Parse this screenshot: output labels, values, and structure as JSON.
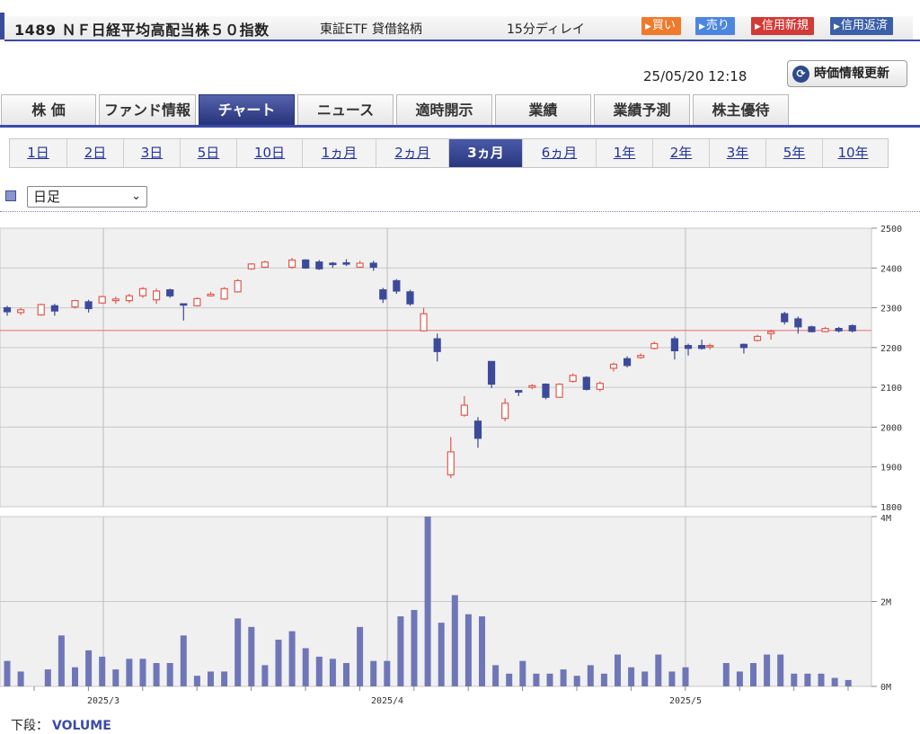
{
  "header": {
    "title": "1489 ＮＦ日経平均高配当株５０指数",
    "market": "東証ETF 貸借銘柄",
    "delay": "15分ディレイ",
    "buttons": {
      "buy": "買い",
      "sell": "売り",
      "margin_new": "信用新規",
      "margin_return": "信用返済"
    },
    "colors": {
      "buy": "#f07a2c",
      "sell": "#4d86e0",
      "margin_new": "#d23a36",
      "margin_return": "#3b5fa8",
      "accent": "#3b4aa8"
    }
  },
  "timestamp": "25/05/20 12:18",
  "refresh": {
    "label": "時価情報更新",
    "icon": "refresh-icon"
  },
  "tabs": [
    {
      "label": "株 価",
      "active": false
    },
    {
      "label": "ファンド情報",
      "active": false
    },
    {
      "label": "チャート",
      "active": true
    },
    {
      "label": "ニュース",
      "active": false
    },
    {
      "label": "適時開示",
      "active": false
    },
    {
      "label": "業績",
      "active": false
    },
    {
      "label": "業績予測",
      "active": false
    },
    {
      "label": "株主優待",
      "active": false
    }
  ],
  "periods": [
    {
      "label": "1日",
      "active": false
    },
    {
      "label": "2日",
      "active": false
    },
    {
      "label": "3日",
      "active": false
    },
    {
      "label": "5日",
      "active": false
    },
    {
      "label": "10日",
      "active": false
    },
    {
      "label": "1ヵ月",
      "active": false
    },
    {
      "label": "2ヵ月",
      "active": false
    },
    {
      "label": "3ヵ月",
      "active": true
    },
    {
      "label": "6ヵ月",
      "active": false
    },
    {
      "label": "1年",
      "active": false
    },
    {
      "label": "2年",
      "active": false
    },
    {
      "label": "3年",
      "active": false
    },
    {
      "label": "5年",
      "active": false
    },
    {
      "label": "10年",
      "active": false
    }
  ],
  "candle_type": "日足",
  "footer": {
    "prefix": "下段：",
    "indicator": "VOLUME"
  },
  "chart_data": {
    "type": "candlestick",
    "title": "",
    "price_axis": {
      "min": 1800,
      "max": 2500,
      "ticks": [
        2500,
        2400,
        2300,
        2200,
        2100,
        2000,
        1900,
        1800
      ]
    },
    "volume_axis": {
      "min": 0,
      "max": 4000000,
      "ticks": [
        "4M",
        "2M",
        "0M"
      ]
    },
    "x_labels": [
      "2025/3",
      "2025/4",
      "2025/5"
    ],
    "reference_line": 2243,
    "colors": {
      "up": "#e05a4f",
      "down": "#3d4a9a",
      "volume": "#6f76b8",
      "ref": "#e57b7b",
      "grid": "#c8c8c8"
    },
    "candles": [
      {
        "o": 2300,
        "h": 2305,
        "l": 2280,
        "c": 2290
      },
      {
        "o": 2288,
        "h": 2300,
        "l": 2282,
        "c": 2295
      },
      {
        "o": 2282,
        "h": 2310,
        "l": 2280,
        "c": 2308
      },
      {
        "o": 2305,
        "h": 2310,
        "l": 2280,
        "c": 2292
      },
      {
        "o": 2302,
        "h": 2320,
        "l": 2298,
        "c": 2318
      },
      {
        "o": 2315,
        "h": 2320,
        "l": 2288,
        "c": 2298
      },
      {
        "o": 2312,
        "h": 2330,
        "l": 2310,
        "c": 2328
      },
      {
        "o": 2318,
        "h": 2328,
        "l": 2310,
        "c": 2322
      },
      {
        "o": 2318,
        "h": 2335,
        "l": 2312,
        "c": 2330
      },
      {
        "o": 2330,
        "h": 2352,
        "l": 2325,
        "c": 2348
      },
      {
        "o": 2320,
        "h": 2348,
        "l": 2310,
        "c": 2342
      },
      {
        "o": 2345,
        "h": 2348,
        "l": 2325,
        "c": 2330
      },
      {
        "o": 2310,
        "h": 2310,
        "l": 2268,
        "c": 2308
      },
      {
        "o": 2305,
        "h": 2326,
        "l": 2303,
        "c": 2323
      },
      {
        "o": 2330,
        "h": 2340,
        "l": 2328,
        "c": 2334
      },
      {
        "o": 2322,
        "h": 2352,
        "l": 2320,
        "c": 2348
      },
      {
        "o": 2340,
        "h": 2372,
        "l": 2338,
        "c": 2368
      },
      {
        "o": 2398,
        "h": 2412,
        "l": 2395,
        "c": 2410
      },
      {
        "o": 2402,
        "h": 2418,
        "l": 2400,
        "c": 2415
      },
      {
        "o": 2402,
        "h": 2425,
        "l": 2398,
        "c": 2420
      },
      {
        "o": 2420,
        "h": 2422,
        "l": 2398,
        "c": 2400
      },
      {
        "o": 2415,
        "h": 2420,
        "l": 2395,
        "c": 2398
      },
      {
        "o": 2412,
        "h": 2415,
        "l": 2400,
        "c": 2410
      },
      {
        "o": 2413,
        "h": 2422,
        "l": 2405,
        "c": 2412
      },
      {
        "o": 2402,
        "h": 2418,
        "l": 2400,
        "c": 2412
      },
      {
        "o": 2412,
        "h": 2418,
        "l": 2393,
        "c": 2402
      },
      {
        "o": 2345,
        "h": 2350,
        "l": 2312,
        "c": 2322
      },
      {
        "o": 2368,
        "h": 2372,
        "l": 2335,
        "c": 2342
      },
      {
        "o": 2340,
        "h": 2345,
        "l": 2305,
        "c": 2310
      },
      {
        "o": 2242,
        "h": 2300,
        "l": 2240,
        "c": 2285
      },
      {
        "o": 2222,
        "h": 2235,
        "l": 2165,
        "c": 2190
      },
      {
        "o": 1880,
        "h": 1975,
        "l": 1872,
        "c": 1938
      },
      {
        "o": 2030,
        "h": 2078,
        "l": 2026,
        "c": 2055
      },
      {
        "o": 2015,
        "h": 2025,
        "l": 1948,
        "c": 1972
      },
      {
        "o": 2165,
        "h": 2165,
        "l": 2098,
        "c": 2108
      },
      {
        "o": 2022,
        "h": 2072,
        "l": 2015,
        "c": 2060
      },
      {
        "o": 2092,
        "h": 2092,
        "l": 2078,
        "c": 2088
      },
      {
        "o": 2100,
        "h": 2108,
        "l": 2095,
        "c": 2104
      },
      {
        "o": 2108,
        "h": 2110,
        "l": 2070,
        "c": 2075
      },
      {
        "o": 2075,
        "h": 2110,
        "l": 2074,
        "c": 2108
      },
      {
        "o": 2115,
        "h": 2135,
        "l": 2112,
        "c": 2130
      },
      {
        "o": 2125,
        "h": 2128,
        "l": 2092,
        "c": 2095
      },
      {
        "o": 2095,
        "h": 2115,
        "l": 2090,
        "c": 2110
      },
      {
        "o": 2148,
        "h": 2162,
        "l": 2140,
        "c": 2158
      },
      {
        "o": 2172,
        "h": 2178,
        "l": 2150,
        "c": 2155
      },
      {
        "o": 2175,
        "h": 2185,
        "l": 2172,
        "c": 2180
      },
      {
        "o": 2198,
        "h": 2215,
        "l": 2195,
        "c": 2210
      },
      {
        "o": 2222,
        "h": 2228,
        "l": 2170,
        "c": 2192
      },
      {
        "o": 2205,
        "h": 2210,
        "l": 2180,
        "c": 2198
      },
      {
        "o": 2205,
        "h": 2220,
        "l": 2195,
        "c": 2198
      },
      {
        "o": 2205,
        "h": 2210,
        "l": 2195,
        "c": 2205
      },
      {
        "o": 2208,
        "h": 2210,
        "l": 2185,
        "c": 2200
      },
      {
        "o": 2218,
        "h": 2232,
        "l": 2215,
        "c": 2228
      },
      {
        "o": 2235,
        "h": 2245,
        "l": 2220,
        "c": 2240
      },
      {
        "o": 2285,
        "h": 2290,
        "l": 2258,
        "c": 2265
      },
      {
        "o": 2272,
        "h": 2278,
        "l": 2235,
        "c": 2252
      },
      {
        "o": 2252,
        "h": 2255,
        "l": 2238,
        "c": 2240
      },
      {
        "o": 2240,
        "h": 2252,
        "l": 2238,
        "c": 2248
      },
      {
        "o": 2248,
        "h": 2252,
        "l": 2238,
        "c": 2242
      },
      {
        "o": 2255,
        "h": 2258,
        "l": 2238,
        "c": 2242
      }
    ],
    "candle_x": [
      0,
      1,
      2.5,
      3.5,
      5,
      6,
      7,
      8,
      9,
      10,
      11,
      12,
      13,
      14,
      15,
      16,
      17,
      18,
      19,
      21,
      22,
      23,
      24,
      25,
      26,
      27,
      27.7,
      28.7,
      29.7,
      30.7,
      31.7,
      32.7,
      33.7,
      34.7,
      35.7,
      36.7,
      37.7,
      38.7,
      39.7,
      40.7,
      41.7,
      42.7,
      43.7,
      44.7,
      45.7,
      46.7,
      47.7,
      49.2,
      50.2,
      51.2,
      51.8,
      54.3,
      55.3,
      56.3,
      57.3,
      58.3,
      59.3,
      60.3,
      61.3,
      62.3,
      63.3
    ],
    "volume": [
      0.6,
      0.35,
      0,
      0.4,
      1.2,
      0.45,
      0.85,
      0.7,
      0.4,
      0.65,
      0.65,
      0.55,
      0.55,
      1.2,
      0.25,
      0.35,
      0.35,
      1.6,
      1.4,
      0.5,
      1.1,
      1.3,
      0.9,
      0.7,
      0.65,
      0.55,
      1.4,
      0.6,
      0.6,
      1.65,
      1.8,
      4.0,
      1.5,
      2.15,
      1.7,
      1.65,
      0.5,
      0.3,
      0.6,
      0.3,
      0.3,
      0.4,
      0.25,
      0.5,
      0.3,
      0.75,
      0.45,
      0.35,
      0.75,
      0.35,
      0.45,
      0,
      0,
      0.55,
      0.35,
      0.55,
      0.75,
      0.75,
      0.3,
      0.3,
      0.3,
      0.2,
      0.15
    ]
  }
}
